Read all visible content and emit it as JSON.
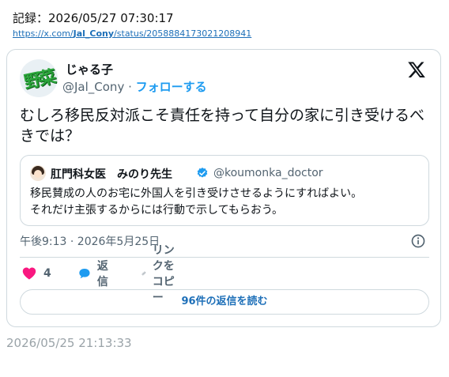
{
  "record": {
    "label": "記録：2026/05/27 07:30:17"
  },
  "source_link": {
    "prefix": "https://x.com/",
    "user": "Jal_Cony",
    "suffix": "/status/2058884173021208941"
  },
  "tweet": {
    "avatar_text": "野菜",
    "display_name": "じゃる子",
    "handle": "@Jal_Cony",
    "separator": " · ",
    "follow_label": "フォローする",
    "text": "むしろ移民反対派こそ責任を持って自分の家に引き受けるべきでは？",
    "timestamp": "午後9:13 · 2026年5月25日"
  },
  "quote": {
    "display_name": "肛門科女医　みのり先生",
    "handle": "@koumonka_doctor",
    "line1": "移民賛成の人のお宅に外国人を引き受けさせるようにすればよい。",
    "line2": "それだけ主張するからには行動で示してもらおう。"
  },
  "actions": {
    "like_count": "4",
    "reply_label": "返信",
    "copy_link_label": "リンクをコピー"
  },
  "replies_button": {
    "label": "96件の返信を読む"
  },
  "footer": {
    "timestamp": "2026/05/25 21:13:33"
  },
  "colors": {
    "like": "#f91880",
    "reply": "#1d9bf0",
    "link": "#1d6fb8",
    "verified": "#1d9bf0"
  },
  "icons": [
    "x-logo-icon",
    "verified-badge-icon",
    "info-icon",
    "heart-icon",
    "reply-bubble-icon",
    "link-icon"
  ]
}
